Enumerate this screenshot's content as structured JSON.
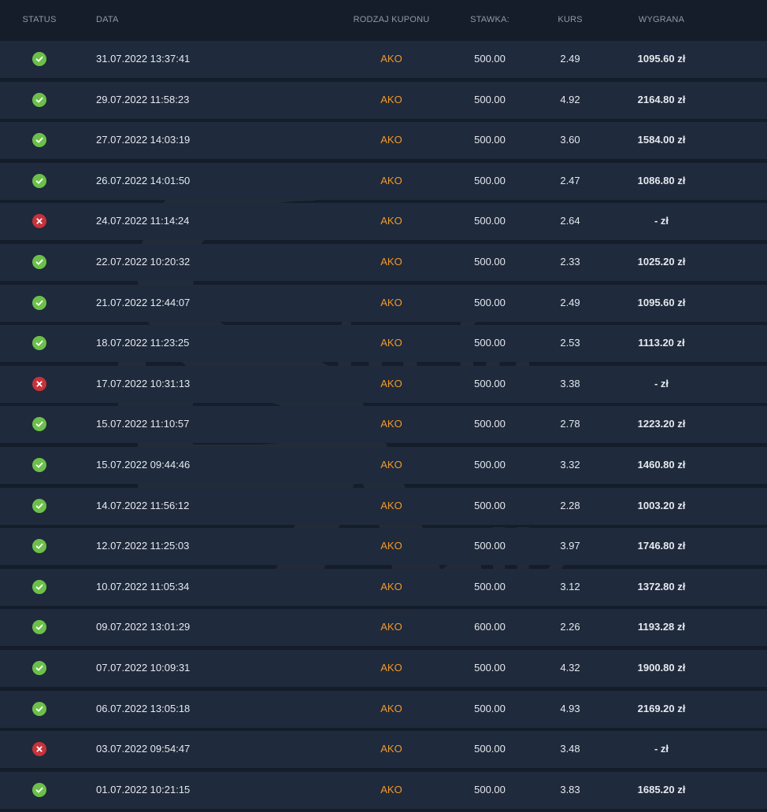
{
  "columns": {
    "status": "STATUS",
    "date": "DATA",
    "coupon_type": "RODZAJ KUPONU",
    "stake": "STAWKA:",
    "odds": "KURS",
    "win": "WYGRANA"
  },
  "colors": {
    "background": "#151d2b",
    "row": "#1f2a3c",
    "accent": "#f39a2a",
    "won": "#6cc04a",
    "lost": "#c8323a"
  },
  "watermark": {
    "word1": "trefa",
    "word2": "naliz"
  },
  "rows": [
    {
      "status": "won",
      "date": "31.07.2022 13:37:41",
      "type": "AKO",
      "stake": "500.00",
      "odds": "2.49",
      "win": "1095.60 zł"
    },
    {
      "status": "won",
      "date": "29.07.2022 11:58:23",
      "type": "AKO",
      "stake": "500.00",
      "odds": "4.92",
      "win": "2164.80 zł"
    },
    {
      "status": "won",
      "date": "27.07.2022 14:03:19",
      "type": "AKO",
      "stake": "500.00",
      "odds": "3.60",
      "win": "1584.00 zł"
    },
    {
      "status": "won",
      "date": "26.07.2022 14:01:50",
      "type": "AKO",
      "stake": "500.00",
      "odds": "2.47",
      "win": "1086.80 zł"
    },
    {
      "status": "lost",
      "date": "24.07.2022 11:14:24",
      "type": "AKO",
      "stake": "500.00",
      "odds": "2.64",
      "win": "- zł"
    },
    {
      "status": "won",
      "date": "22.07.2022 10:20:32",
      "type": "AKO",
      "stake": "500.00",
      "odds": "2.33",
      "win": "1025.20 zł"
    },
    {
      "status": "won",
      "date": "21.07.2022 12:44:07",
      "type": "AKO",
      "stake": "500.00",
      "odds": "2.49",
      "win": "1095.60 zł"
    },
    {
      "status": "won",
      "date": "18.07.2022 11:23:25",
      "type": "AKO",
      "stake": "500.00",
      "odds": "2.53",
      "win": "1113.20 zł"
    },
    {
      "status": "lost",
      "date": "17.07.2022 10:31:13",
      "type": "AKO",
      "stake": "500.00",
      "odds": "3.38",
      "win": "- zł"
    },
    {
      "status": "won",
      "date": "15.07.2022 11:10:57",
      "type": "AKO",
      "stake": "500.00",
      "odds": "2.78",
      "win": "1223.20 zł"
    },
    {
      "status": "won",
      "date": "15.07.2022 09:44:46",
      "type": "AKO",
      "stake": "500.00",
      "odds": "3.32",
      "win": "1460.80 zł"
    },
    {
      "status": "won",
      "date": "14.07.2022 11:56:12",
      "type": "AKO",
      "stake": "500.00",
      "odds": "2.28",
      "win": "1003.20 zł"
    },
    {
      "status": "won",
      "date": "12.07.2022 11:25:03",
      "type": "AKO",
      "stake": "500.00",
      "odds": "3.97",
      "win": "1746.80 zł"
    },
    {
      "status": "won",
      "date": "10.07.2022 11:05:34",
      "type": "AKO",
      "stake": "500.00",
      "odds": "3.12",
      "win": "1372.80 zł"
    },
    {
      "status": "won",
      "date": "09.07.2022 13:01:29",
      "type": "AKO",
      "stake": "600.00",
      "odds": "2.26",
      "win": "1193.28 zł"
    },
    {
      "status": "won",
      "date": "07.07.2022 10:09:31",
      "type": "AKO",
      "stake": "500.00",
      "odds": "4.32",
      "win": "1900.80 zł"
    },
    {
      "status": "won",
      "date": "06.07.2022 13:05:18",
      "type": "AKO",
      "stake": "500.00",
      "odds": "4.93",
      "win": "2169.20 zł"
    },
    {
      "status": "lost",
      "date": "03.07.2022 09:54:47",
      "type": "AKO",
      "stake": "500.00",
      "odds": "3.48",
      "win": "- zł"
    },
    {
      "status": "won",
      "date": "01.07.2022 10:21:15",
      "type": "AKO",
      "stake": "500.00",
      "odds": "3.83",
      "win": "1685.20 zł"
    }
  ]
}
